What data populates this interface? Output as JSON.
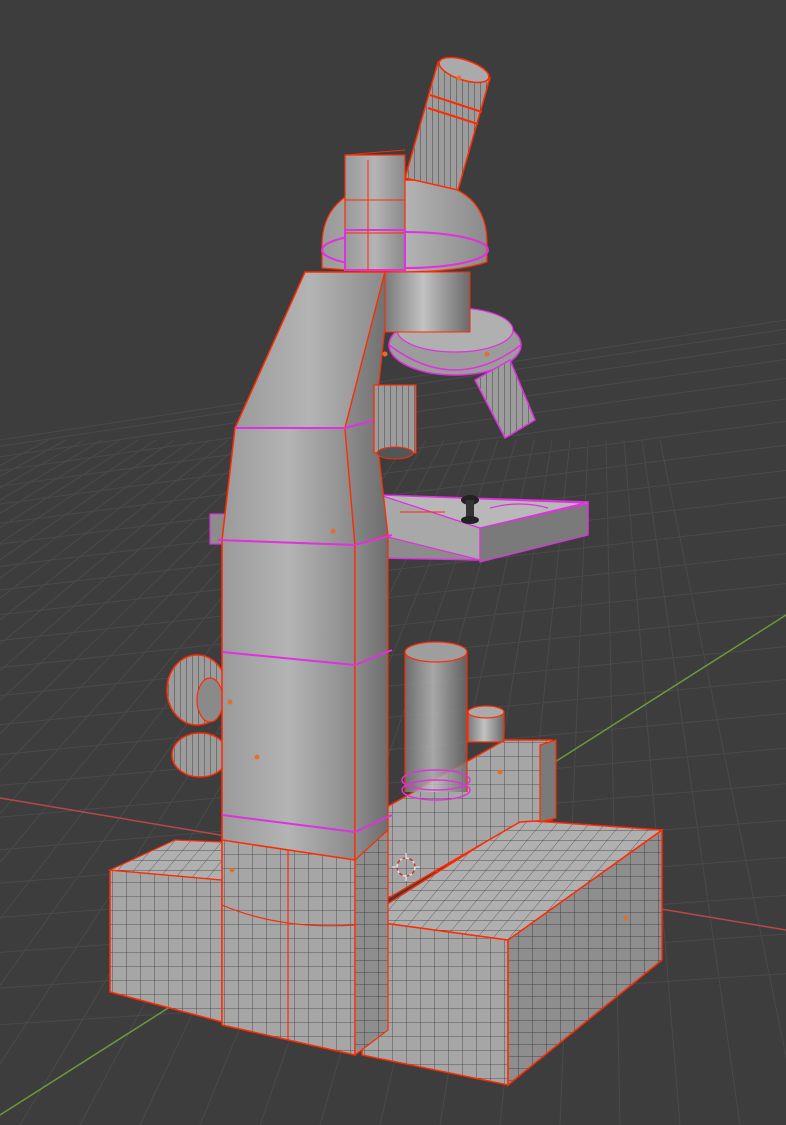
{
  "viewport": {
    "background": "#3d3d3d",
    "grid_color": "#4a4a4a",
    "x_axis_color": "#b84848",
    "y_axis_color": "#6a9a38"
  },
  "model": {
    "object": "microscope",
    "mode": "edit-mode-wireframe",
    "seam_color": "#ff2a00",
    "selection_color": "#e030e0",
    "mesh_color": "#9a9a9a",
    "vertex_color": "#e07030"
  },
  "origin_marker": {
    "icon": "3d-cursor-icon"
  }
}
